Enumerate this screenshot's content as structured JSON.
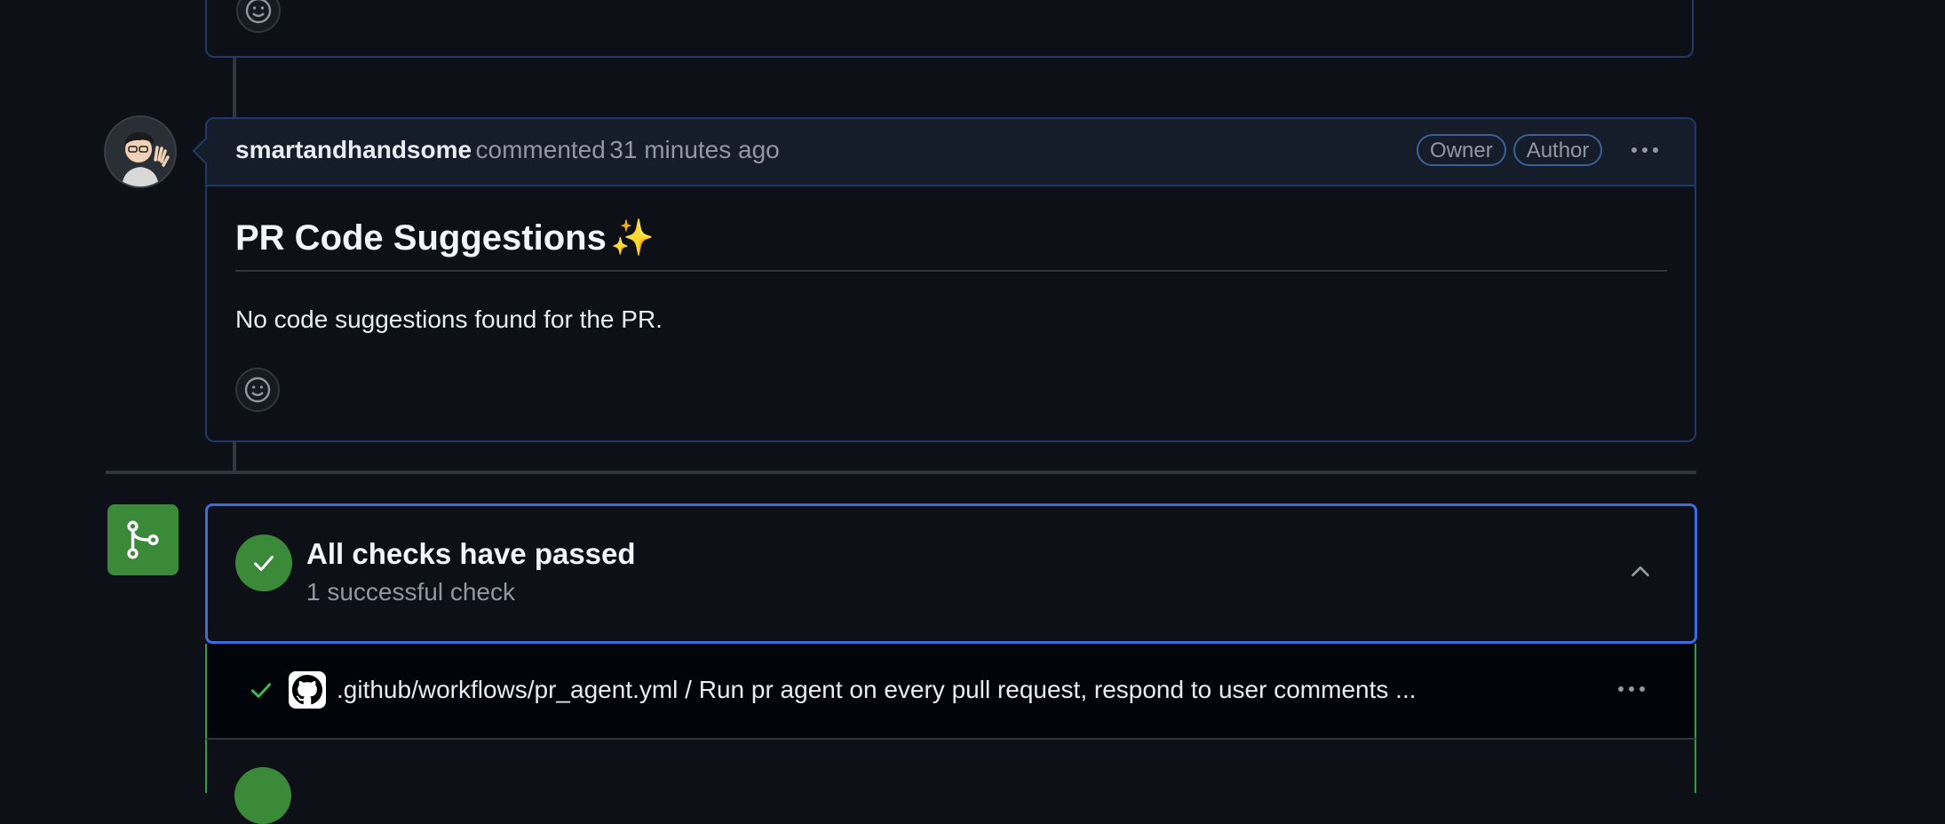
{
  "comment": {
    "author": "smartandhandsome",
    "action": "commented",
    "time": "31 minutes ago",
    "badges": [
      "Owner",
      "Author"
    ],
    "heading": "PR Code Suggestions",
    "heading_emoji": "✨",
    "body": "No code suggestions found for the PR."
  },
  "checks": {
    "title": "All checks have passed",
    "subtitle": "1 successful check",
    "rows": [
      {
        "status": "success",
        "name": ".github/workflows/pr_agent.yml / Run pr agent on every pull request, respond to user comments ..."
      }
    ]
  },
  "colors": {
    "accent_blue": "#3b6de0",
    "success_green": "#3a8a3a",
    "background": "#0d1117"
  },
  "icons": [
    "smiley-icon",
    "kebab-icon",
    "merge-icon",
    "check-icon",
    "chevron-up-icon",
    "github-icon"
  ]
}
